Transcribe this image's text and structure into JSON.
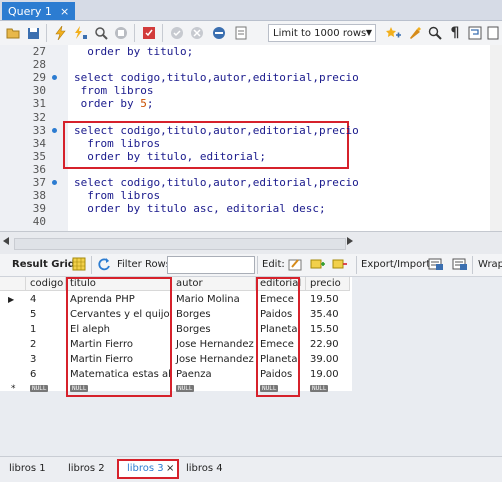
{
  "query_tab": {
    "label": "Query 1",
    "close": "×"
  },
  "toolbar": {
    "limit_label": "Limit to 1000 rows"
  },
  "editor": {
    "lines": [
      {
        "n": "27",
        "dot": false,
        "text": "  order by titulo;"
      },
      {
        "n": "28",
        "dot": false,
        "text": ""
      },
      {
        "n": "29",
        "dot": true,
        "text": "select codigo,titulo,autor,editorial,precio"
      },
      {
        "n": "30",
        "dot": false,
        "text": " from libros"
      },
      {
        "n": "31",
        "dot": false,
        "text": " order by ",
        "num": "5",
        "after": ";"
      },
      {
        "n": "32",
        "dot": false,
        "text": ""
      },
      {
        "n": "33",
        "dot": true,
        "text": "select codigo,titulo,autor,editorial,precio"
      },
      {
        "n": "34",
        "dot": false,
        "text": "  from libros"
      },
      {
        "n": "35",
        "dot": false,
        "text": "  order by titulo, editorial;"
      },
      {
        "n": "36",
        "dot": false,
        "text": ""
      },
      {
        "n": "37",
        "dot": true,
        "text": "select codigo,titulo,autor,editorial,precio"
      },
      {
        "n": "38",
        "dot": false,
        "text": "  from libros"
      },
      {
        "n": "39",
        "dot": false,
        "text": "  order by titulo asc, editorial desc;"
      },
      {
        "n": "40",
        "dot": false,
        "text": ""
      }
    ]
  },
  "result_toolbar": {
    "result_grid": "Result Grid",
    "filter_rows": "Filter Rows:",
    "edit": "Edit:",
    "export_import": "Export/Import:",
    "wrap": "Wrap"
  },
  "grid": {
    "columns": [
      "codigo",
      "titulo",
      "autor",
      "editorial",
      "precio"
    ],
    "rows": [
      [
        "4",
        "Aprenda PHP",
        "Mario Molina",
        "Emece",
        "19.50"
      ],
      [
        "5",
        "Cervantes y el quijote",
        "Borges",
        "Paidos",
        "35.40"
      ],
      [
        "1",
        "El aleph",
        "Borges",
        "Planeta",
        "15.50"
      ],
      [
        "2",
        "Martin Fierro",
        "Jose Hernandez",
        "Emece",
        "22.90"
      ],
      [
        "3",
        "Martin Fierro",
        "Jose Hernandez",
        "Planeta",
        "39.00"
      ],
      [
        "6",
        "Matematica estas ahi",
        "Paenza",
        "Paidos",
        "19.00"
      ]
    ],
    "null_label": "NULL",
    "new_row_marker": "*",
    "current_row_marker": "▶"
  },
  "bottom_tabs": [
    {
      "label": "libros 1"
    },
    {
      "label": "libros 2"
    },
    {
      "label": "libros 3",
      "close": "×",
      "active": true
    },
    {
      "label": "libros 4"
    }
  ],
  "colors": {
    "accent": "#2c7cd1",
    "highlight": "#d6212b",
    "code": "#1a1a8c",
    "number": "#c94f00"
  }
}
